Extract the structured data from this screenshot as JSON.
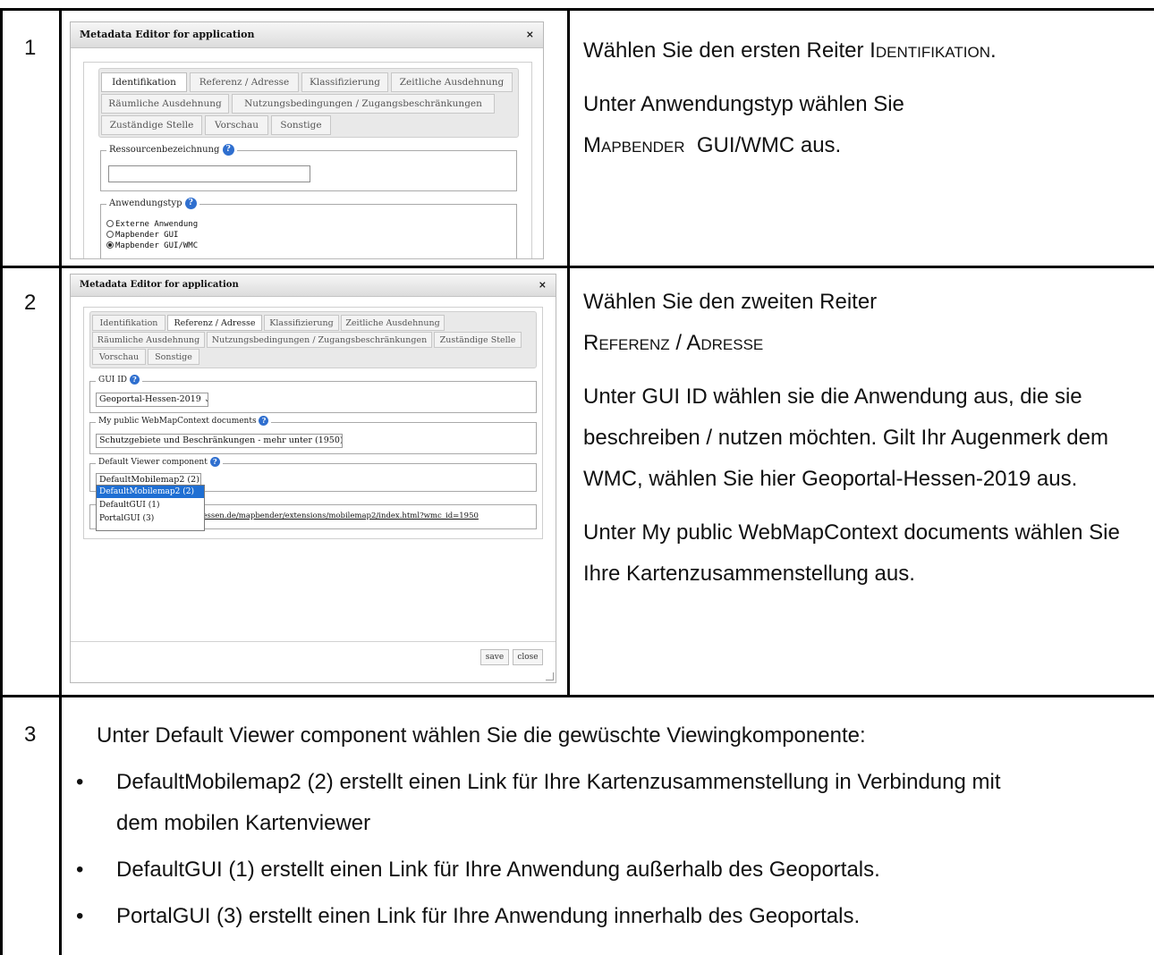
{
  "rows": [
    {
      "number": "1"
    },
    {
      "number": "2"
    },
    {
      "number": "3"
    }
  ],
  "row1": {
    "line1_prefix": "Wählen Sie den ersten Reiter ",
    "line1_tab_name": "Identifikation",
    "line1_suffix": ".",
    "line2": "Unter Anwendungstyp wählen Sie",
    "line3_sc": "Mapbender",
    "line3_rest": "  GUI/WMC aus."
  },
  "row2": {
    "line1": "Wählen Sie den zweiten Reiter",
    "line2_tab_name": "Referenz / Adresse",
    "para2": "Unter GUI ID wählen sie die Anwendung aus, die sie beschreiben / nutzen möchten. Gilt Ihr Augenmerk dem WMC, wählen Sie hier Geoportal-Hessen-2019 aus.",
    "para3": "Unter My public WebMapContext documents wählen Sie Ihre Kartenzusammenstellung aus."
  },
  "row3": {
    "intro": "Unter Default Viewer component wählen Sie die gewüschte Viewingkomponente:",
    "bullets": [
      "DefaultMobilemap2 (2) erstellt einen Link für Ihre Kartenzusammenstellung in Verbindung mit dem mobilen Kartenviewer",
      "DefaultGUI (1) erstellt einen Link für Ihre Anwendung außerhalb des Geoportals.",
      "PortalGUI (3) erstellt einen Link für Ihre Anwendung innerhalb des Geoportals."
    ]
  },
  "dialog1": {
    "title": "Metadata Editor for application",
    "close": "×",
    "tabs": [
      "Identifikation",
      "Referenz / Adresse",
      "Klassifizierung",
      "Zeitliche Ausdehnung",
      "Räumliche Ausdehnung",
      "Nutzungsbedingungen / Zugangsbeschränkungen",
      "Zuständige Stelle",
      "Vorschau",
      "Sonstige"
    ],
    "field_resource": "Ressourcenbezeichnung",
    "field_type": "Anwendungstyp",
    "options": [
      "Externe Anwendung",
      "Mapbender GUI",
      "Mapbender GUI/WMC"
    ],
    "selected_option": "Mapbender GUI/WMC"
  },
  "dialog2": {
    "title": "Metadata Editor for application",
    "close": "×",
    "tabs": [
      "Identifikation",
      "Referenz / Adresse",
      "Klassifizierung",
      "Zeitliche Ausdehnung",
      "Räumliche Ausdehnung",
      "Nutzungsbedingungen / Zugangsbeschränkungen",
      "Zuständige Stelle",
      "Vorschau",
      "Sonstige"
    ],
    "gui_id_label": "GUI ID",
    "gui_id_value": "Geoportal-Hessen-2019",
    "wmc_label": "My public WebMapContext documents",
    "wmc_value": "Schutzgebiete und Beschränkungen - mehr unter (1950)",
    "viewer_label": "Default Viewer component",
    "viewer_value": "DefaultMobilemap2 (2)",
    "viewer_options": [
      "DefaultMobilemap2 (2)",
      "DefaultGUI (1)",
      "PortalGUI (3)"
    ],
    "link_text": "hessen.de/mapbender/extensions/mobilemap2/index.html?wmc_id=1950",
    "save": "save",
    "close_btn": "close"
  }
}
